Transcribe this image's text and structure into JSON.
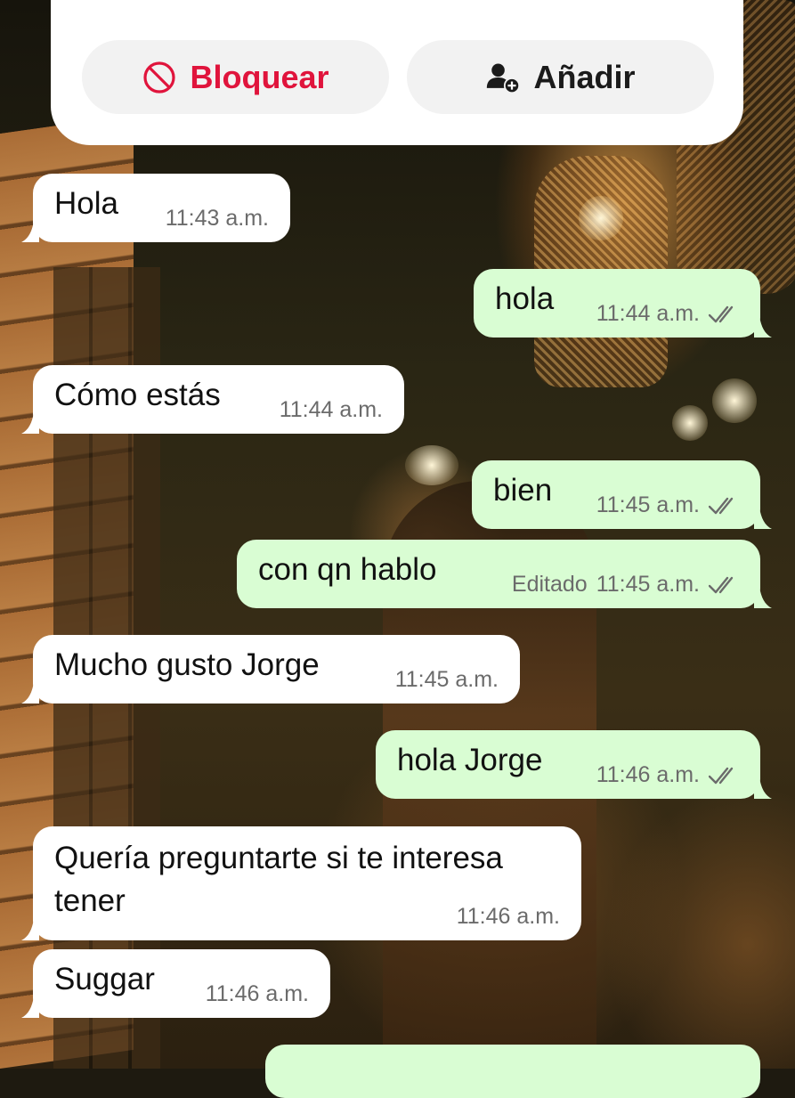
{
  "actions": {
    "block_label": "Bloquear",
    "add_label": "Añadir"
  },
  "colors": {
    "block_red": "#e0143c",
    "incoming_bubble": "#ffffff",
    "outgoing_bubble": "#d9fdd3",
    "meta_gray": "#6b6b6b"
  },
  "messages": [
    {
      "dir": "in",
      "text": "Hola",
      "time": "11:43 a.m."
    },
    {
      "dir": "out",
      "text": "hola",
      "time": "11:44 a.m.",
      "status": "read-double-check"
    },
    {
      "dir": "in",
      "text": "Cómo estás",
      "time": "11:44 a.m."
    },
    {
      "dir": "out",
      "text": "bien",
      "time": "11:45 a.m.",
      "status": "read-double-check"
    },
    {
      "dir": "out",
      "text": "con qn hablo",
      "edited": "Editado",
      "time": "11:45 a.m.",
      "status": "read-double-check"
    },
    {
      "dir": "in",
      "text": "Mucho gusto Jorge",
      "time": "11:45 a.m."
    },
    {
      "dir": "out",
      "text": "hola Jorge",
      "time": "11:46 a.m.",
      "status": "read-double-check"
    },
    {
      "dir": "in",
      "text": "Quería preguntarte si te interesa tener",
      "time": "11:46 a.m."
    },
    {
      "dir": "in",
      "text": "Suggar",
      "time": "11:46 a.m."
    }
  ],
  "icons": {
    "block": "block-circle-slash-icon",
    "add": "add-contact-icon",
    "status": "double-check-icon"
  }
}
